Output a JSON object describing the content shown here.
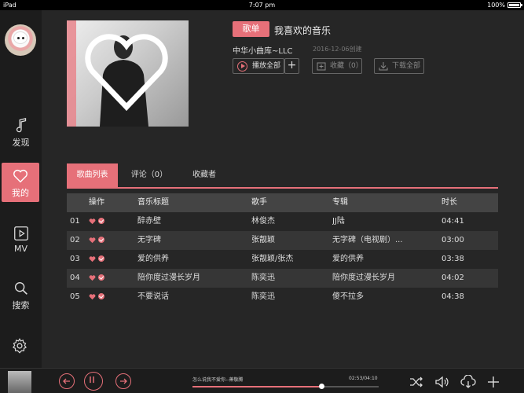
{
  "status_bar": {
    "device": "iPad",
    "time": "7:07 pm",
    "battery": "100%"
  },
  "sidebar": {
    "items": [
      {
        "label": "发现",
        "icon": "music-note-icon"
      },
      {
        "label": "我的",
        "icon": "heart-icon",
        "active": true
      },
      {
        "label": "MV",
        "icon": "video-play-icon"
      },
      {
        "label": "搜索",
        "icon": "search-icon"
      }
    ],
    "settings_icon": "gear-icon"
  },
  "playlist": {
    "tag": "歌单",
    "title": "我喜欢的音乐",
    "creator": "中华小曲库~LLC",
    "created": "2016-12-06创建",
    "play_all": "播放全部",
    "add": "+",
    "favorite": "收藏（0）",
    "download_all": "下载全部"
  },
  "tabs": [
    {
      "label": "歌曲列表",
      "active": true
    },
    {
      "label": "评论（0）"
    },
    {
      "label": "收藏者"
    }
  ],
  "table": {
    "headers": {
      "action": "操作",
      "title": "音乐标题",
      "artist": "歌手",
      "album": "专辑",
      "duration": "时长"
    },
    "rows": [
      {
        "num": "01",
        "title": "醉赤壁",
        "artist": "林俊杰",
        "album": "JJ陆",
        "duration": "04:41"
      },
      {
        "num": "02",
        "title": "无字碑",
        "artist": "张靓颖",
        "album": "无字碑（电视剧）...",
        "duration": "03:00"
      },
      {
        "num": "03",
        "title": "爱的供养",
        "artist": "张靓颖/张杰",
        "album": "爱的供养",
        "duration": "03:38"
      },
      {
        "num": "04",
        "title": "陪你度过漫长岁月",
        "artist": "陈奕迅",
        "album": "陪你度过漫长岁月",
        "duration": "04:02"
      },
      {
        "num": "05",
        "title": "不要说话",
        "artist": "陈奕迅",
        "album": "傻不拉多",
        "duration": "04:38"
      }
    ]
  },
  "player": {
    "now_playing": "怎么说我不爱你--萧敬腾",
    "time": "02:53/04:10",
    "progress": 0.69,
    "accent": "#e67079"
  }
}
